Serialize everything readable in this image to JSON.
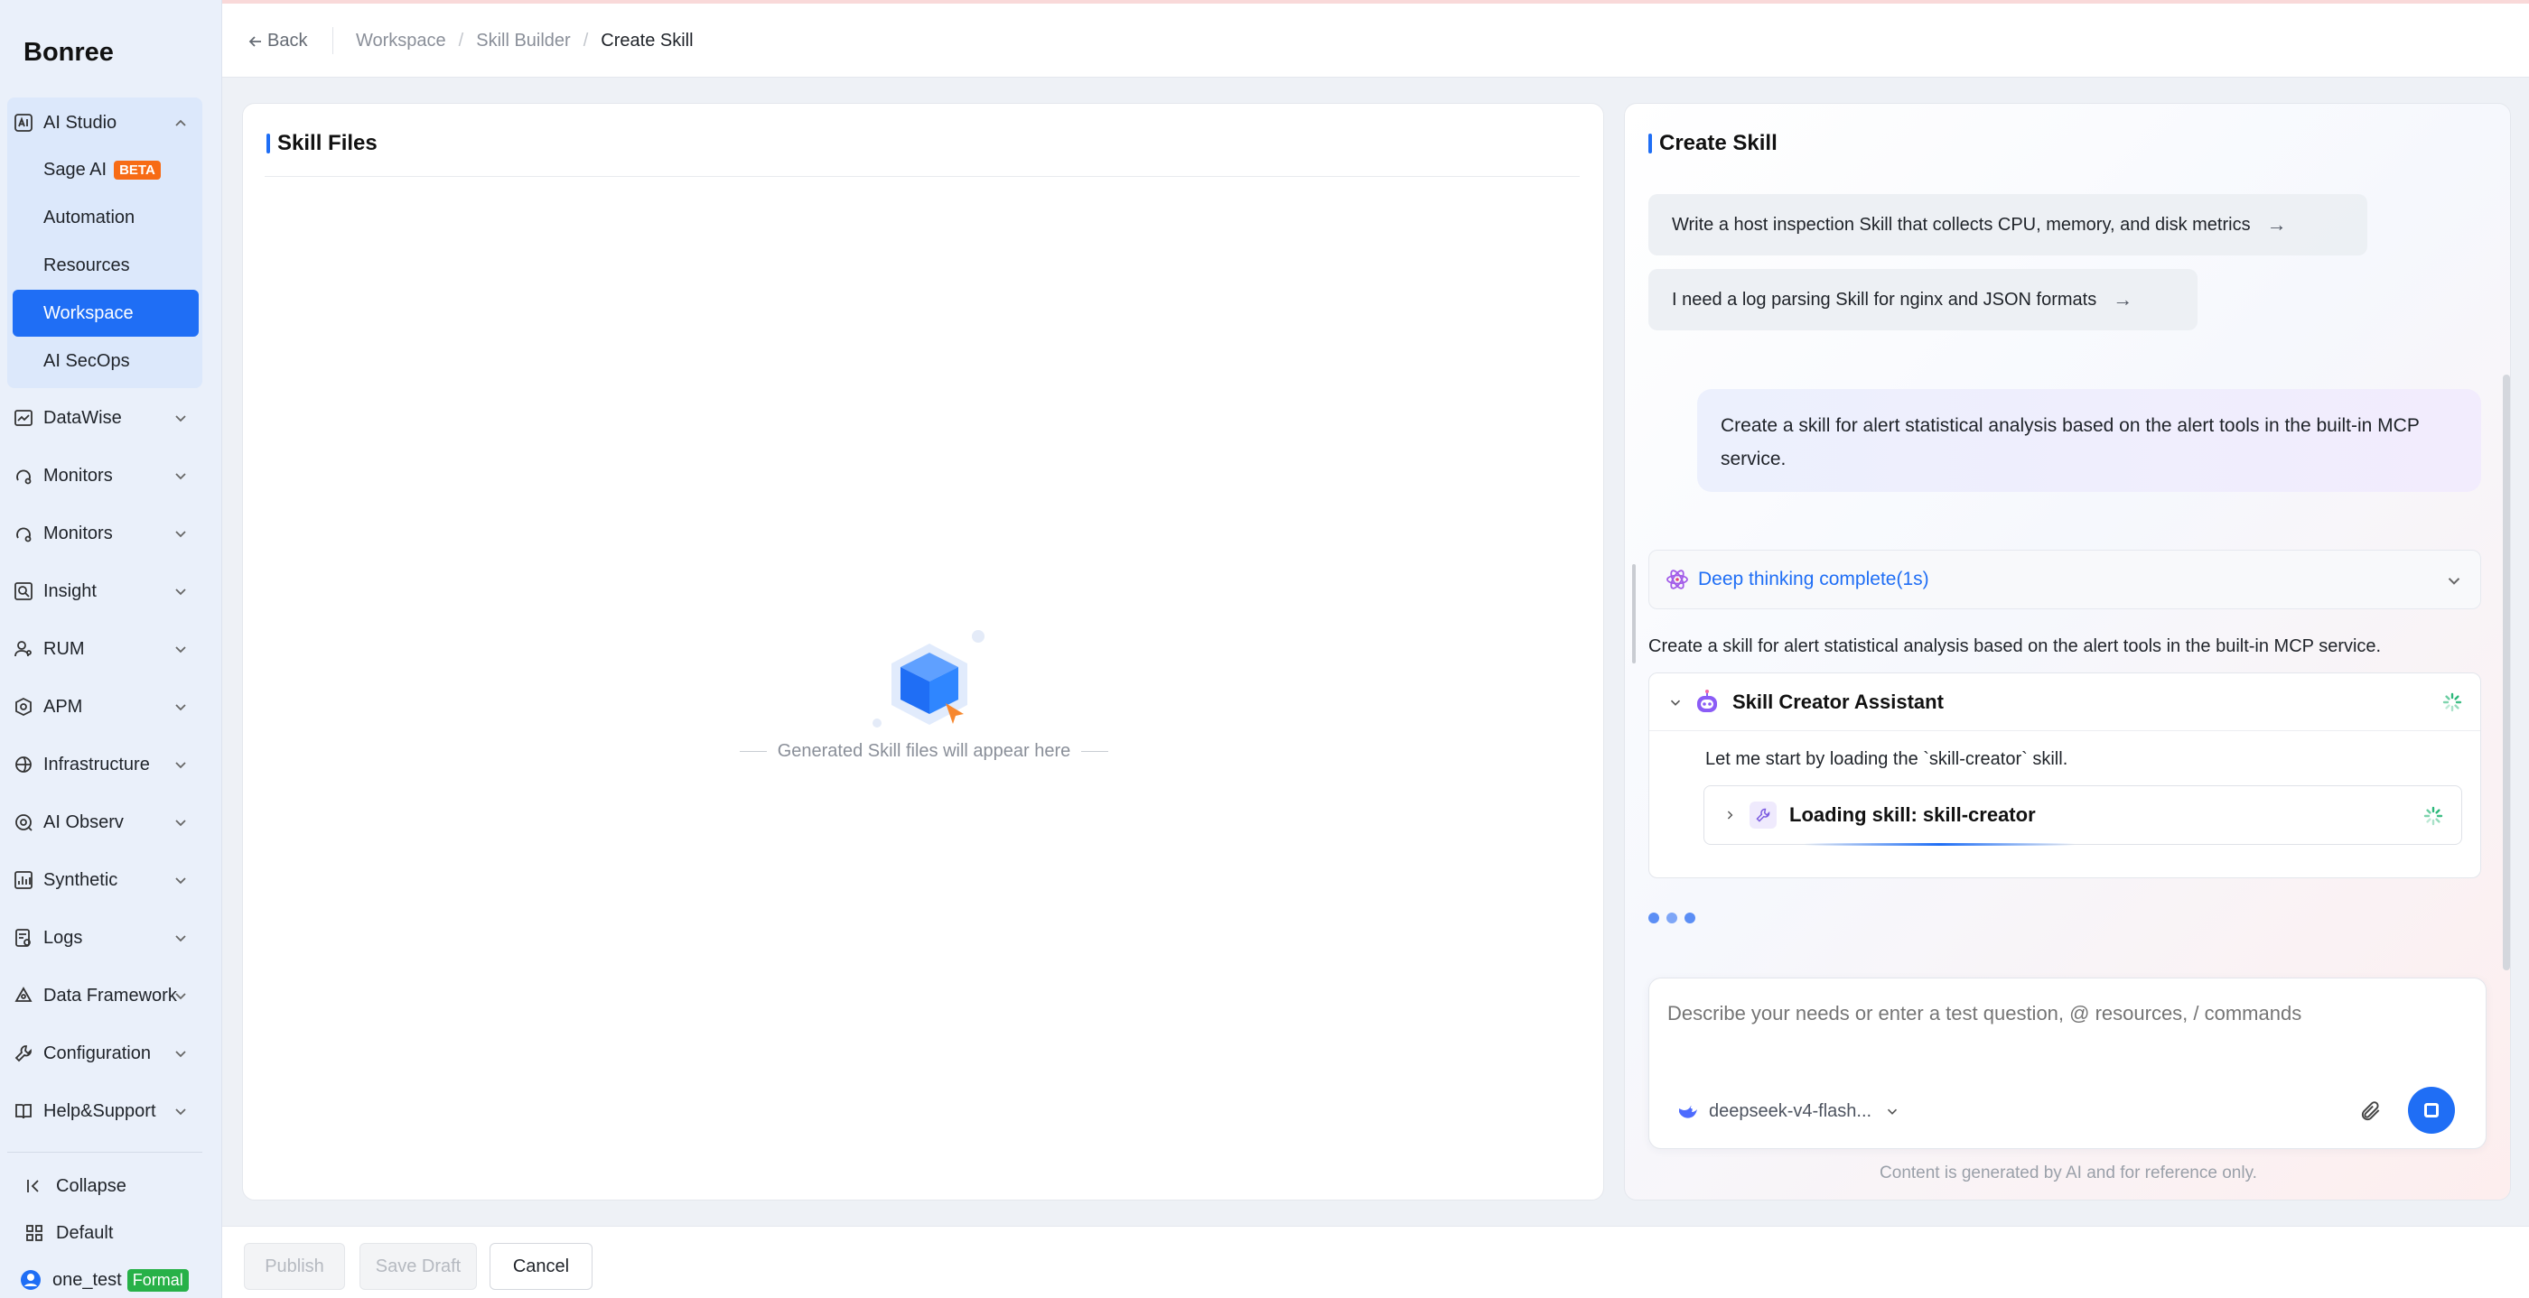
{
  "app": {
    "brand": "Bonree"
  },
  "header": {
    "back_label": "Back",
    "breadcrumbs": [
      "Workspace",
      "Skill Builder",
      "Create Skill"
    ]
  },
  "sidebar": {
    "ai_studio": {
      "label": "AI Studio",
      "items": [
        {
          "label": "Sage AI",
          "badge": "BETA"
        },
        {
          "label": "Automation"
        },
        {
          "label": "Resources"
        },
        {
          "label": "Workspace",
          "active": true
        },
        {
          "label": "AI SecOps"
        }
      ]
    },
    "sections": [
      {
        "label": "DataWise",
        "icon": "chart-icon"
      },
      {
        "label": "Monitors",
        "icon": "monitor-icon"
      },
      {
        "label": "Monitors",
        "icon": "monitor-icon"
      },
      {
        "label": "Insight",
        "icon": "magnifier-icon"
      },
      {
        "label": "RUM",
        "icon": "users-icon"
      },
      {
        "label": "APM",
        "icon": "apm-icon"
      },
      {
        "label": "Infrastructure",
        "icon": "infrastructure-icon"
      },
      {
        "label": "AI Observ",
        "icon": "observ-icon"
      },
      {
        "label": "Synthetic",
        "icon": "synthetic-icon"
      },
      {
        "label": "Logs",
        "icon": "logs-icon"
      },
      {
        "label": "Data Framework",
        "icon": "framework-icon"
      },
      {
        "label": "Configuration",
        "icon": "wrench-icon"
      },
      {
        "label": "Help&Support",
        "icon": "book-icon"
      }
    ],
    "footer": {
      "collapse_label": "Collapse",
      "space_label": "Default",
      "user_name": "one_test",
      "user_badge": "Formal"
    }
  },
  "skill_files": {
    "title": "Skill Files",
    "empty_text": "Generated Skill files will appear here"
  },
  "create_skill": {
    "title": "Create Skill",
    "suggestions": [
      "Write a host inspection Skill that collects CPU, memory, and disk metrics",
      "I need a log parsing Skill for nginx and JSON formats"
    ],
    "user_message": "Create a skill for alert statistical analysis based on the alert tools in the built-in MCP service.",
    "thinking_label": "Deep thinking complete(1s)",
    "thinking_text": "Create a skill for alert statistical analysis based on the alert tools in the built-in MCP service.",
    "assistant": {
      "name": "Skill Creator Assistant",
      "message": "Let me start by loading the `skill-creator` skill.",
      "tool_call": "Loading skill: skill-creator"
    },
    "composer": {
      "placeholder": "Describe your needs or enter a test question, @ resources, / commands",
      "model": "deepseek-v4-flash..."
    },
    "disclaimer": "Content is generated by AI and for reference only."
  },
  "footer_actions": {
    "publish": "Publish",
    "save_draft": "Save Draft",
    "cancel": "Cancel"
  },
  "colors": {
    "primary": "#1f6ef5",
    "beta_badge": "#f76b15",
    "formal_badge": "#27b148",
    "spinner": "#2cb87a"
  }
}
